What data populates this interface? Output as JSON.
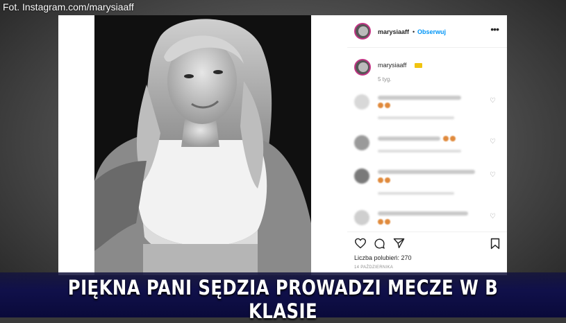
{
  "credit": "Fot. Instagram.com/marysiaaff",
  "post": {
    "header": {
      "username": "marysiaaff",
      "separator": "•",
      "follow_label": "Obserwuj",
      "more_icon": "more-dots-icon"
    },
    "caption": {
      "username": "marysiaaff",
      "time": "5 tyg."
    },
    "comments_blurred": 4,
    "actions": {
      "icons": [
        "heart-icon",
        "comment-icon",
        "share-icon",
        "bookmark-icon"
      ],
      "likes_text": "Liczba polubień: 270",
      "date": "14 PAŹDZIERNIKA"
    }
  },
  "headline": "PIĘKNA PANI SĘDZIA PROWADZI MECZE W B KLASIE",
  "colors": {
    "link": "#0095f6",
    "banner": "#10104a",
    "ring": "#c13584"
  }
}
